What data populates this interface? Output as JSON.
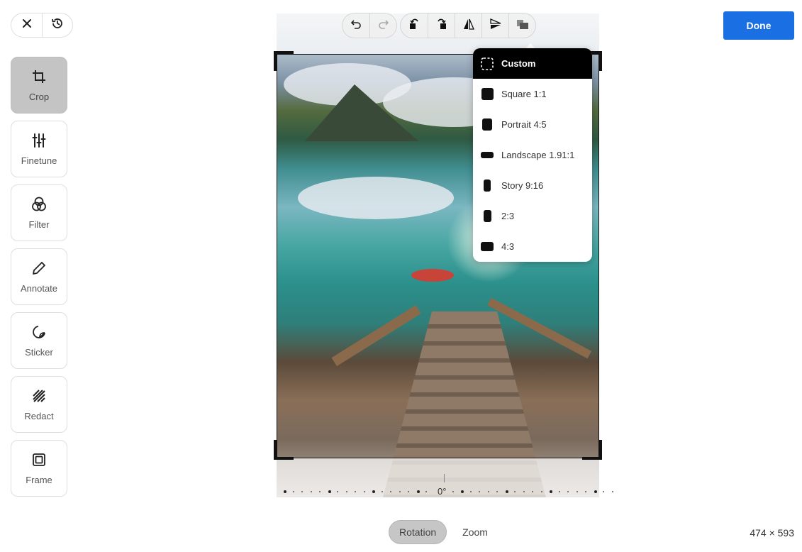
{
  "header": {
    "close_icon": "close-icon",
    "history_icon": "history-icon",
    "done_label": "Done"
  },
  "tools": [
    {
      "label": "Crop",
      "icon": "crop-icon",
      "active": true
    },
    {
      "label": "Finetune",
      "icon": "sliders-icon",
      "active": false
    },
    {
      "label": "Filter",
      "icon": "filter-circles-icon",
      "active": false
    },
    {
      "label": "Annotate",
      "icon": "pencil-icon",
      "active": false
    },
    {
      "label": "Sticker",
      "icon": "sticker-icon",
      "active": false
    },
    {
      "label": "Redact",
      "icon": "redact-icon",
      "active": false
    },
    {
      "label": "Frame",
      "icon": "frame-icon",
      "active": false
    }
  ],
  "toolbar": {
    "undo_icon": "undo-icon",
    "redo_icon": "redo-icon",
    "rotate_left_icon": "rotate-left-icon",
    "rotate_right_icon": "rotate-right-icon",
    "flip_horizontal_icon": "flip-horizontal-icon",
    "flip_vertical_icon": "flip-vertical-icon",
    "aspect_ratio_icon": "aspect-ratio-icon"
  },
  "aspect_menu": {
    "items": [
      {
        "label": "Custom",
        "selected": true
      },
      {
        "label": "Square 1:1",
        "selected": false
      },
      {
        "label": "Portrait 4:5",
        "selected": false
      },
      {
        "label": "Landscape 1.91:1",
        "selected": false
      },
      {
        "label": "Story 9:16",
        "selected": false
      },
      {
        "label": "2:3",
        "selected": false
      },
      {
        "label": "4:3",
        "selected": false
      }
    ]
  },
  "rotation": {
    "value_label": "0°"
  },
  "bottom_tabs": [
    {
      "label": "Rotation",
      "active": true
    },
    {
      "label": "Zoom",
      "active": false
    }
  ],
  "image_size": "474 × 593"
}
